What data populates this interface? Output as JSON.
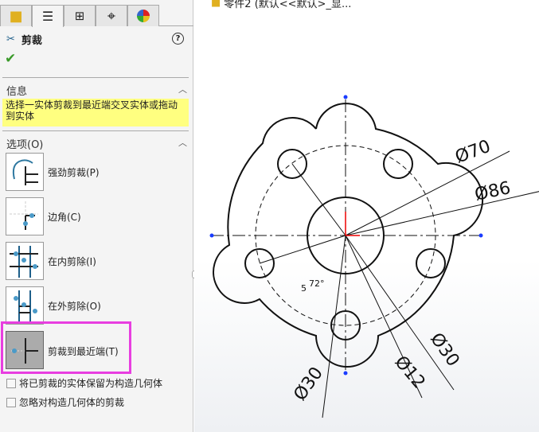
{
  "breadcrumb": {
    "text": "零件2 (默认<<默认>_显..."
  },
  "panel": {
    "tabs": [
      "feature-manager",
      "property-manager",
      "configuration-manager",
      "dimxpert-manager",
      "display-manager"
    ],
    "title": "剪裁",
    "help": "?",
    "info": {
      "heading": "信息",
      "text": "选择一实体剪裁到最近端交叉实体或拖动到实体"
    },
    "options": {
      "heading": "选项(O)",
      "items": [
        {
          "label": "强劲剪裁(P)"
        },
        {
          "label": "边角(C)"
        },
        {
          "label": "在内剪除(I)"
        },
        {
          "label": "在外剪除(O)"
        },
        {
          "label": "剪裁到最近端(T)",
          "selected": true
        }
      ],
      "checkboxes": [
        {
          "label": "将已剪裁的实体保留为构造几何体",
          "checked": false
        },
        {
          "label": "忽略对构造几何体的剪裁",
          "checked": false
        }
      ]
    }
  },
  "drawing": {
    "dims": [
      "Ø70",
      "Ø86",
      "Ø30",
      "Ø12",
      "Ø30"
    ],
    "angle": "72°",
    "angle_prefix": "5"
  },
  "colors": {
    "highlight": "#e83ee0",
    "info_bg": "#ffff80"
  }
}
